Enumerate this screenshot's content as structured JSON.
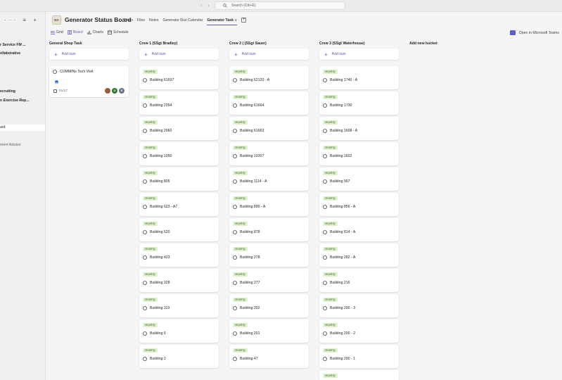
{
  "titlebar": {
    "search_placeholder": "Search (Ctrl+E)"
  },
  "leftpane": {
    "tools": "··· ≡ +",
    "items": [
      {
        "label": "r Service FM ...",
        "bold": true
      },
      {
        "label": "ollaborative",
        "bold": true
      },
      {
        "label": "ecruiting",
        "bold": true
      },
      {
        "label": "n Exercise Rep...",
        "bold": true
      },
      {
        "label": "ard",
        "selected": true
      },
      {
        "label": "ment Advisor",
        "muted": true
      }
    ]
  },
  "header": {
    "team_initials": "GC",
    "title": "Generator Status Board",
    "tabs": [
      "Posts",
      "Files",
      "Notes",
      "Generator Run Calendar",
      "Generator Task"
    ],
    "active_tab_suffix": "∨",
    "add_tab": "+"
  },
  "views": {
    "grid": "Grid",
    "board": "Board",
    "charts": "Charts",
    "schedule": "Schedule"
  },
  "open_in_teams": "Open in Microsoft Teams",
  "add_task_label": "Add task",
  "label_text": "Monthly",
  "columns": [
    {
      "title": "General Shop Task",
      "special_card": {
        "title": "CUMMINs Tech Visit",
        "date": "01/17",
        "avatars": [
          {
            "initial": "",
            "color": "#9b5a3c"
          },
          {
            "initial": "G",
            "color": "#2f7d32"
          },
          {
            "initial": "E",
            "color": "#6e7781"
          }
        ]
      },
      "tasks": []
    },
    {
      "title": "Crew 1 (SSgt Bradley)",
      "tasks": [
        "Building 61697",
        "Building 2354",
        "Building 2060",
        "Building 1050",
        "Building 805",
        "Building 623 - A7",
        "Building 620",
        "Building 423",
        "Building 328",
        "Building 119",
        "Building 6",
        "Building 2"
      ]
    },
    {
      "title": "Crew 2 ( (SSgt Sauer)",
      "tasks": [
        "Building 62120 - A",
        "Building 61664",
        "Building 61663",
        "Building 10307",
        "Building 1114 - A",
        "Building 890 - A",
        "Building 878",
        "Building 278",
        "Building 277",
        "Building 202",
        "Building 201",
        "Building 47"
      ]
    },
    {
      "title": "Crew 3 (SSgt Waterhouse)",
      "tasks": [
        "Building 1740 - A",
        "Building 1730",
        "Building 1608 - A",
        "Building 1602",
        "Building 907",
        "Building 856 - A",
        "Building 814 - A",
        "Building 282 - A",
        "Building 216",
        "Building 200 - 3",
        "Building 200 - 2",
        "Building 200 - 1",
        ""
      ]
    }
  ],
  "add_bucket": "Add new bucket"
}
